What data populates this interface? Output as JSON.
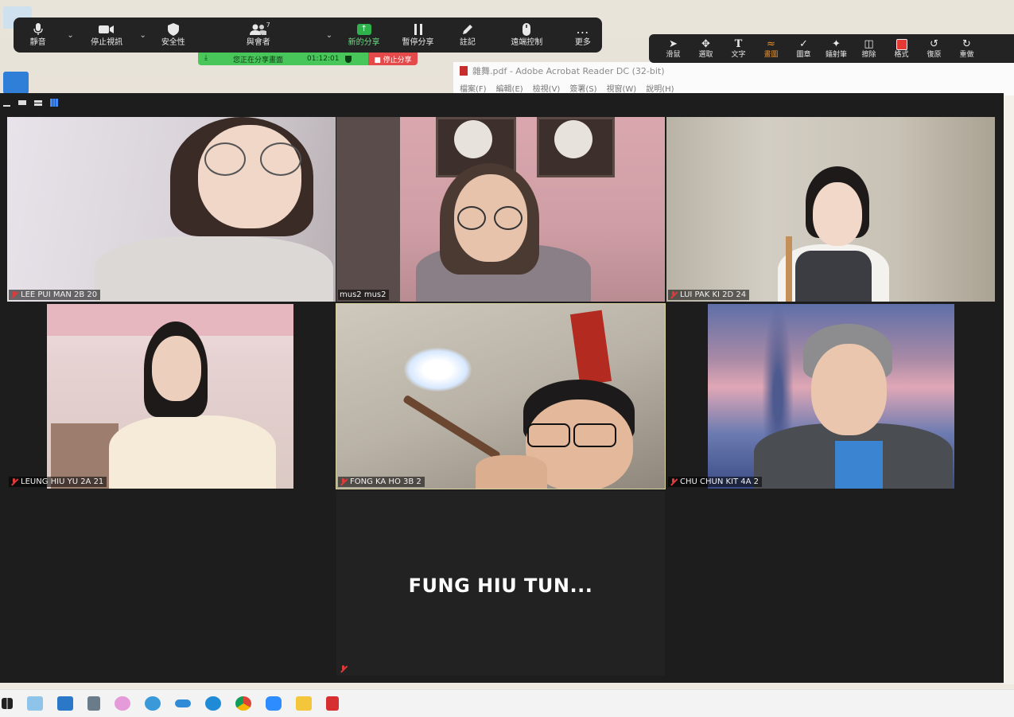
{
  "zoom_toolbar": {
    "mute_label": "靜音",
    "stop_video_label": "停止視訊",
    "security_label": "安全性",
    "participants_label": "與會者",
    "participants_count": "7",
    "new_share_label": "新的分享",
    "pause_share_label": "暫停分享",
    "annotate_label": "註記",
    "remote_control_label": "遠端控制",
    "more_label": "更多"
  },
  "share_bar": {
    "status_text": "您正在分享畫面",
    "timer": "01:12:01",
    "stop_label": "■ 停止分享"
  },
  "annotation_toolbar": {
    "items": [
      {
        "label": "滑鼠",
        "icon": "mouse-pointer-icon"
      },
      {
        "label": "選取",
        "icon": "move-select-icon"
      },
      {
        "label": "文字",
        "icon": "text-icon"
      },
      {
        "label": "畫圖",
        "icon": "draw-icon"
      },
      {
        "label": "圖章",
        "icon": "stamp-check-icon"
      },
      {
        "label": "鐳射筆",
        "icon": "laser-pointer-icon"
      },
      {
        "label": "擦除",
        "icon": "eraser-icon"
      },
      {
        "label": "格式",
        "icon": "format-color-icon"
      },
      {
        "label": "復原",
        "icon": "undo-icon"
      },
      {
        "label": "重做",
        "icon": "redo-icon"
      }
    ],
    "active_color": "#e8912c",
    "format_swatch": "#e53935"
  },
  "acrobat": {
    "title": "雜舞.pdf - Adobe Acrobat Reader DC (32-bit)",
    "menu": [
      "檔案(F)",
      "編輯(E)",
      "檢視(V)",
      "簽署(S)",
      "視窗(W)",
      "說明(H)"
    ]
  },
  "gallery": {
    "participants": [
      {
        "name": "LEE PUI MAN 2B 20",
        "muted": true
      },
      {
        "name": "mus2 mus2",
        "muted": false
      },
      {
        "name": "LUI PAK KI 2D 24",
        "muted": true
      },
      {
        "name": "LEUNG HIU YU 2A 21",
        "muted": true
      },
      {
        "name": "FONG KA HO 3B 2",
        "muted": true
      },
      {
        "name": "CHU CHUN KIT 4A 2",
        "muted": true
      }
    ],
    "no_video_participant": "FUNG HIU TUN..."
  },
  "taskbar": {
    "icons": [
      "windows-start-icon",
      "file-explorer-icon",
      "photos-icon",
      "calculator-icon",
      "itunes-icon",
      "ie-icon",
      "onedrive-icon",
      "edge-icon",
      "chrome-icon",
      "zoom-icon",
      "folder-icon",
      "acrobat-icon"
    ]
  }
}
